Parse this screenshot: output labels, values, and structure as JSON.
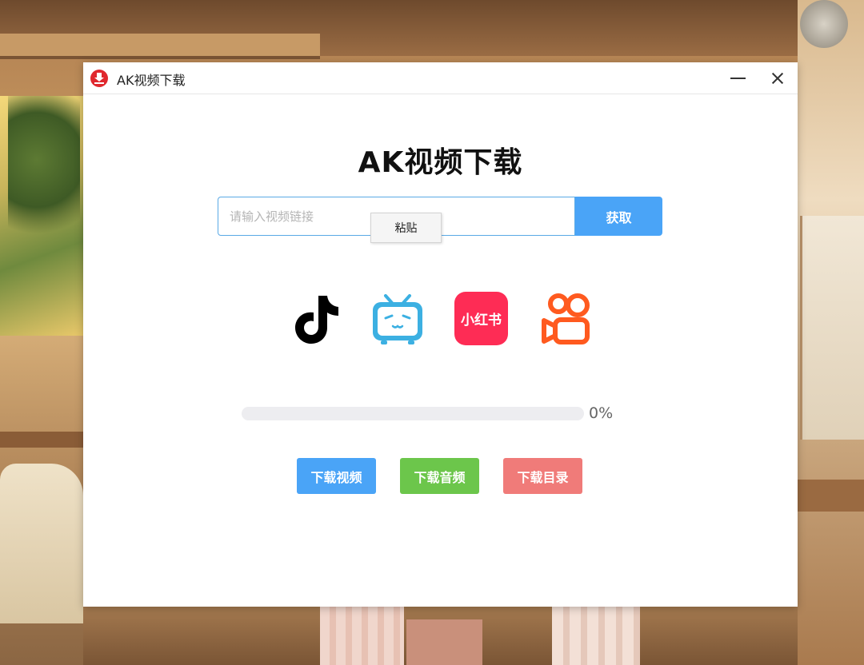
{
  "window": {
    "title": "AK视频下载"
  },
  "main": {
    "heading": "AK视频下载",
    "url_input": {
      "value": "",
      "placeholder": "请输入视频链接"
    },
    "fetch_label": "获取",
    "context_menu": {
      "paste_label": "粘贴"
    },
    "platforms": [
      {
        "name": "tiktok",
        "icon": "tiktok-icon",
        "color": "#000000"
      },
      {
        "name": "bilibili",
        "icon": "bilibili-icon",
        "color": "#3cb0e2"
      },
      {
        "name": "xiaohongshu",
        "icon": "xiaohongshu-icon",
        "color": "#fe2c55",
        "label": "小红书"
      },
      {
        "name": "kuaishou",
        "icon": "kuaishou-icon",
        "color": "#ff5a1f"
      }
    ],
    "progress": {
      "value": 0,
      "text": "0%"
    },
    "buttons": {
      "download_video": "下载视频",
      "download_audio": "下载音频",
      "open_folder": "下载目录"
    }
  },
  "colors": {
    "accent": "#4aa4f7",
    "audio": "#6cc64b",
    "folder": "#f07b79",
    "app_icon": "#e0282e"
  }
}
